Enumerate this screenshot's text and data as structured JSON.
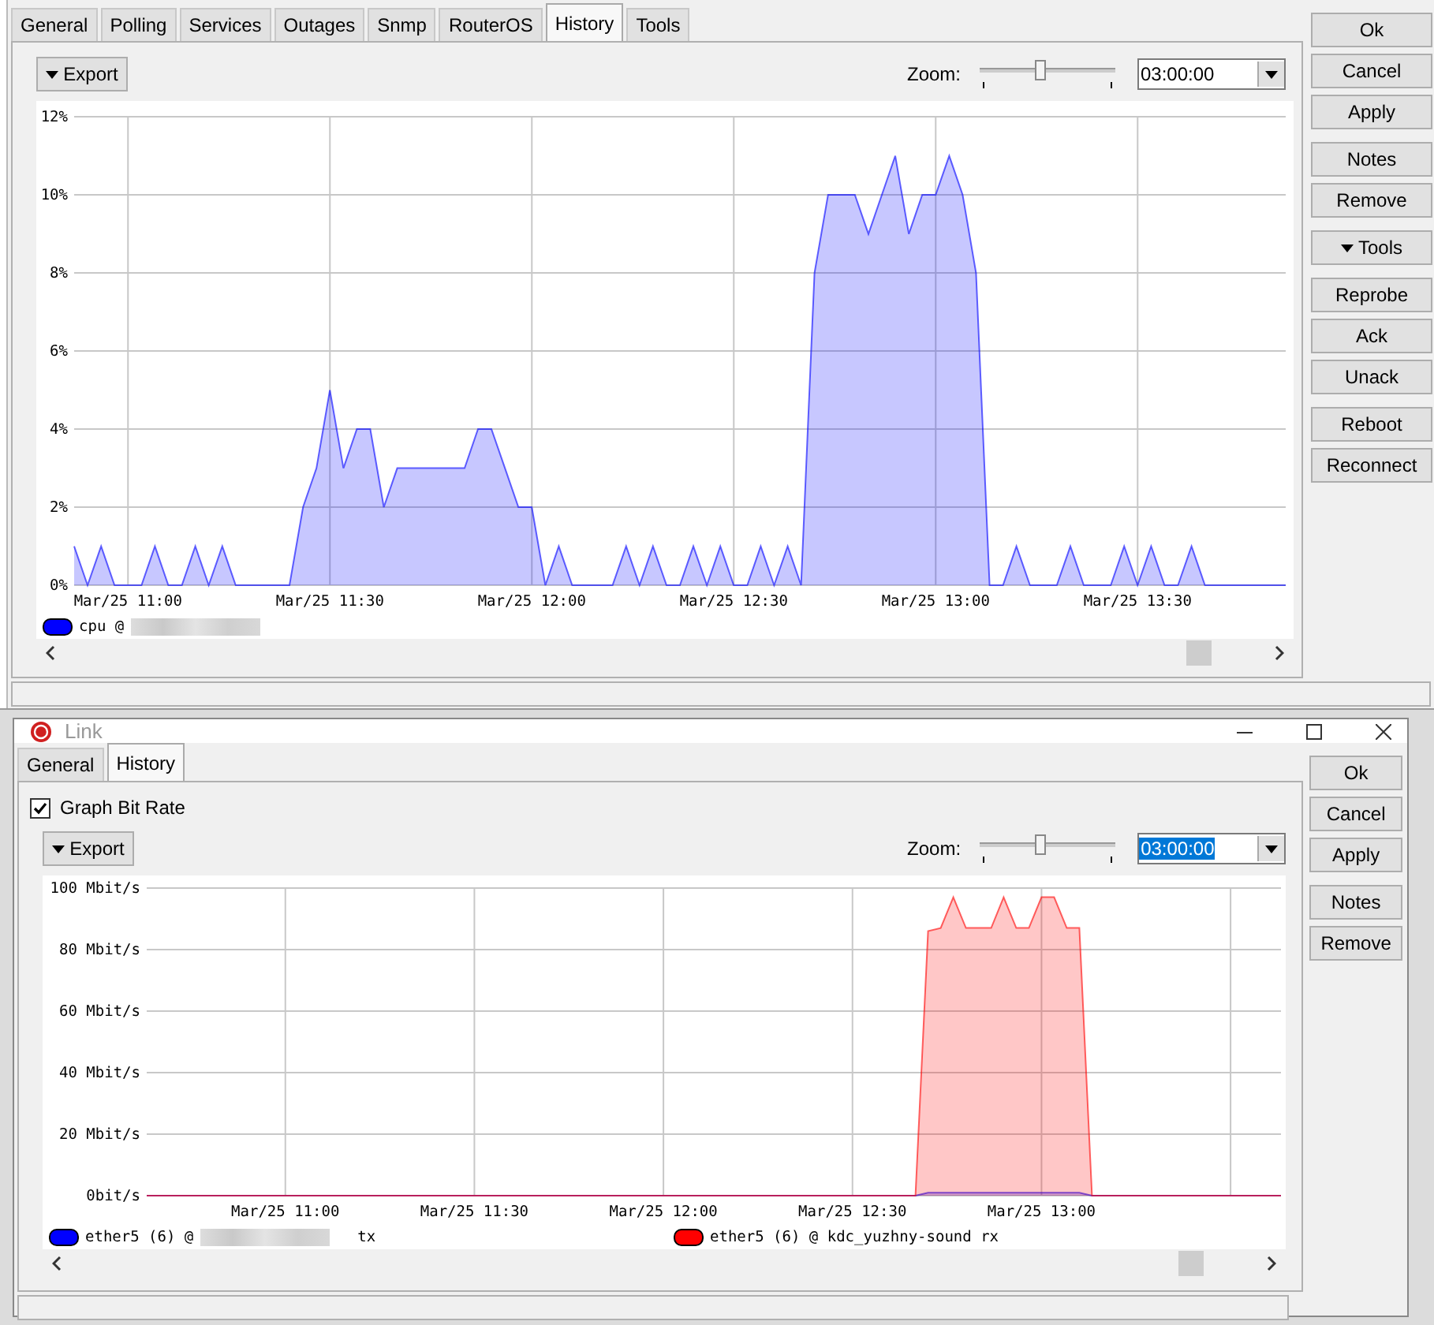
{
  "main_window": {
    "tabs": [
      {
        "label": "General",
        "selected": false
      },
      {
        "label": "Polling",
        "selected": false
      },
      {
        "label": "Services",
        "selected": false
      },
      {
        "label": "Outages",
        "selected": false
      },
      {
        "label": "Snmp",
        "selected": false
      },
      {
        "label": "RouterOS",
        "selected": false
      },
      {
        "label": "History",
        "selected": true
      },
      {
        "label": "Tools",
        "selected": false
      }
    ],
    "history": {
      "export_label": "Export",
      "zoom_label": "Zoom:",
      "zoom": {
        "level": 0.44
      },
      "zoom_value": "03:00:00",
      "zoom_text_selected": false,
      "chart_data": {
        "type": "area",
        "grid": true,
        "ylim": [
          0,
          12
        ],
        "categories": [
          null,
          null,
          null,
          null,
          "Mar/25 11:00",
          null,
          null,
          null,
          null,
          null,
          null,
          null,
          null,
          null,
          null,
          null,
          null,
          null,
          null,
          "Mar/25 11:30",
          null,
          null,
          null,
          null,
          null,
          null,
          null,
          null,
          null,
          null,
          null,
          null,
          null,
          null,
          "Mar/25 12:00",
          null,
          null,
          null,
          null,
          null,
          null,
          null,
          null,
          null,
          null,
          null,
          null,
          null,
          null,
          "Mar/25 12:30",
          null,
          null,
          null,
          null,
          null,
          null,
          null,
          null,
          null,
          null,
          null,
          null,
          null,
          null,
          "Mar/25 13:00",
          null,
          null,
          null,
          null,
          null,
          null,
          null,
          null,
          null,
          null,
          null,
          null,
          null,
          null,
          "Mar/25 13:30",
          null,
          null,
          null,
          null,
          null,
          null,
          null,
          null,
          null,
          null,
          null
        ],
        "yticks": [
          {
            "value": 0,
            "label": "0%"
          },
          {
            "value": 2,
            "label": "2%"
          },
          {
            "value": 4,
            "label": "4%"
          },
          {
            "value": 6,
            "label": "6%"
          },
          {
            "value": 8,
            "label": "8%"
          },
          {
            "value": 10,
            "label": "10%"
          },
          {
            "value": 12,
            "label": "12%"
          }
        ],
        "series": [
          {
            "color": "#0000ff",
            "values": [
              1,
              0,
              1,
              0,
              0,
              0,
              1,
              0,
              0,
              1,
              0,
              1,
              0,
              0,
              0,
              0,
              0,
              2,
              3,
              5,
              3,
              4,
              4,
              2,
              3,
              3,
              3,
              3,
              3,
              3,
              4,
              4,
              3,
              2,
              2,
              0,
              1,
              0,
              0,
              0,
              0,
              1,
              0,
              1,
              0,
              0,
              1,
              0,
              1,
              0,
              0,
              1,
              0,
              1,
              0,
              8,
              10,
              10,
              10,
              9,
              10,
              11,
              9,
              10,
              10,
              11,
              10,
              8,
              0,
              0,
              1,
              0,
              0,
              0,
              1,
              0,
              0,
              0,
              1,
              0,
              1,
              0,
              0,
              1,
              0,
              0,
              0,
              0,
              0,
              0,
              0
            ]
          }
        ]
      },
      "legend": [
        {
          "label": "cpu @",
          "color": "#0000ff",
          "redacted": true
        }
      ]
    },
    "buttons": [
      [
        {
          "label": "Ok",
          "menu": false
        },
        {
          "label": "Cancel",
          "menu": false
        },
        {
          "label": "Apply",
          "menu": false
        }
      ],
      [
        {
          "label": "Notes",
          "menu": false
        },
        {
          "label": "Remove",
          "menu": false
        }
      ],
      [
        {
          "label": "Tools",
          "menu": true
        }
      ],
      [
        {
          "label": "Reprobe",
          "menu": false
        },
        {
          "label": "Ack",
          "menu": false
        },
        {
          "label": "Unack",
          "menu": false
        }
      ],
      [
        {
          "label": "Reboot",
          "menu": false
        },
        {
          "label": "Reconnect",
          "menu": false
        }
      ]
    ]
  },
  "link_window": {
    "title": "Link",
    "tabs": [
      {
        "label": "General",
        "selected": false
      },
      {
        "label": "History",
        "selected": true
      }
    ],
    "graph_bit_rate": {
      "label": "Graph Bit Rate",
      "checked": true
    },
    "history": {
      "export_label": "Export",
      "zoom_label": "Zoom:",
      "zoom": {
        "level": 0.44
      },
      "zoom_value": "03:00:00",
      "zoom_text_selected": true,
      "chart_data": {
        "type": "area",
        "grid": true,
        "ylim": [
          0,
          100
        ],
        "categories": [
          null,
          null,
          null,
          null,
          null,
          null,
          null,
          null,
          null,
          null,
          null,
          "Mar/25 11:00",
          null,
          null,
          null,
          null,
          null,
          null,
          null,
          null,
          null,
          null,
          null,
          null,
          null,
          null,
          "Mar/25 11:30",
          null,
          null,
          null,
          null,
          null,
          null,
          null,
          null,
          null,
          null,
          null,
          null,
          null,
          null,
          "Mar/25 12:00",
          null,
          null,
          null,
          null,
          null,
          null,
          null,
          null,
          null,
          null,
          null,
          null,
          null,
          null,
          "Mar/25 12:30",
          null,
          null,
          null,
          null,
          null,
          null,
          null,
          null,
          null,
          null,
          null,
          null,
          null,
          null,
          "Mar/25 13:00",
          null,
          null,
          null,
          null,
          null,
          null,
          null,
          null,
          null,
          null,
          null,
          null,
          null,
          null,
          null,
          null,
          null,
          null,
          null
        ],
        "yticks": [
          {
            "value": 0,
            "label": "0bit/s"
          },
          {
            "value": 20,
            "label": "20 Mbit/s"
          },
          {
            "value": 40,
            "label": "40 Mbit/s"
          },
          {
            "value": 60,
            "label": "60 Mbit/s"
          },
          {
            "value": 80,
            "label": "80 Mbit/s"
          },
          {
            "value": 100,
            "label": "100 Mbit/s"
          }
        ],
        "series": [
          {
            "color": "#0000ff",
            "values": [
              0,
              0,
              0,
              0,
              0,
              0,
              0,
              0,
              0,
              0,
              0,
              0,
              0,
              0,
              0,
              0,
              0,
              0,
              0,
              0,
              0,
              0,
              0,
              0,
              0,
              0,
              0,
              0,
              0,
              0,
              0,
              0,
              0,
              0,
              0,
              0,
              0,
              0,
              0,
              0,
              0,
              0,
              0,
              0,
              0,
              0,
              0,
              0,
              0,
              0,
              0,
              0,
              0,
              0,
              0,
              0,
              0,
              0,
              0,
              0,
              0,
              0,
              1,
              1,
              1,
              1,
              1,
              1,
              1,
              1,
              1,
              1,
              1,
              1,
              1,
              0,
              0,
              0,
              0,
              0,
              0,
              0,
              0,
              0,
              0,
              0,
              0,
              0,
              0,
              0,
              0
            ]
          },
          {
            "color": "#ff0000",
            "values": [
              0,
              0,
              0,
              0,
              0,
              0,
              0,
              0,
              0,
              0,
              0,
              0,
              0,
              0,
              0,
              0,
              0,
              0,
              0,
              0,
              0,
              0,
              0,
              0,
              0,
              0,
              0,
              0,
              0,
              0,
              0,
              0,
              0,
              0,
              0,
              0,
              0,
              0,
              0,
              0,
              0,
              0,
              0,
              0,
              0,
              0,
              0,
              0,
              0,
              0,
              0,
              0,
              0,
              0,
              0,
              0,
              0,
              0,
              0,
              0,
              0,
              0,
              86,
              87,
              97,
              87,
              87,
              87,
              97,
              87,
              87,
              97,
              97,
              87,
              87,
              0,
              0,
              0,
              0,
              0,
              0,
              0,
              0,
              0,
              0,
              0,
              0,
              0,
              0,
              0,
              0
            ]
          }
        ]
      },
      "legend": [
        {
          "label": "ether5 (6) @",
          "color": "#0000ff",
          "redacted": true,
          "suffix": "tx"
        },
        {
          "label": "ether5 (6) @ kdc_yuzhny-sound rx",
          "color": "#ff0000",
          "redacted": false
        }
      ]
    },
    "buttons": [
      [
        {
          "label": "Ok",
          "menu": false
        },
        {
          "label": "Cancel",
          "menu": false
        },
        {
          "label": "Apply",
          "menu": false
        }
      ],
      [
        {
          "label": "Notes",
          "menu": false
        },
        {
          "label": "Remove",
          "menu": false
        }
      ]
    ]
  }
}
